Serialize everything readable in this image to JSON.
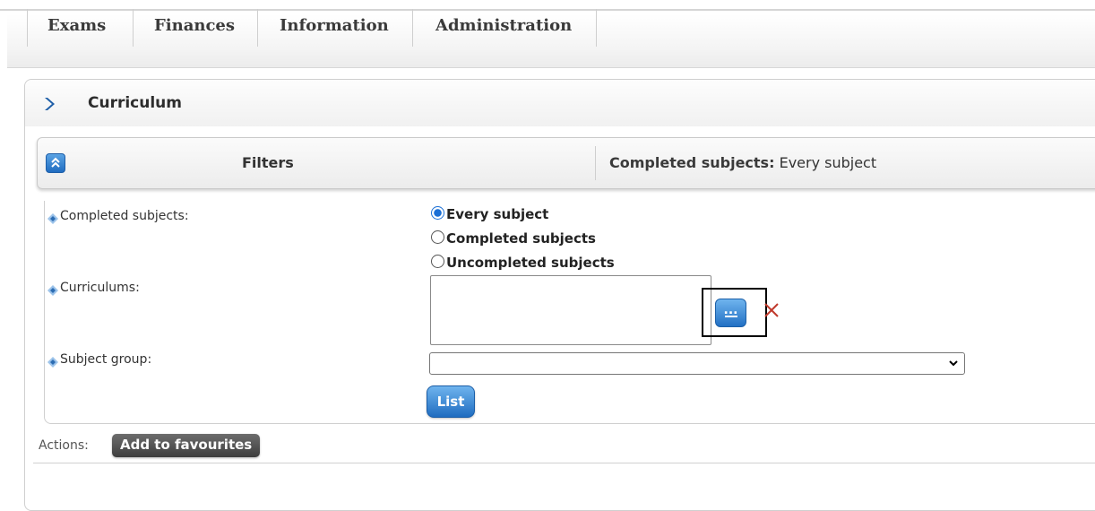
{
  "nav": {
    "items": [
      {
        "label": "Exams"
      },
      {
        "label": "Finances"
      },
      {
        "label": "Information"
      },
      {
        "label": "Administration"
      }
    ]
  },
  "panel": {
    "title": "Curriculum"
  },
  "filterbar": {
    "title": "Filters",
    "summary_label": "Completed subjects:",
    "summary_value": "Every subject"
  },
  "filters": {
    "completed_subjects": {
      "label": "Completed subjects:",
      "options": [
        {
          "label": "Every subject",
          "selected": true
        },
        {
          "label": "Completed subjects",
          "selected": false
        },
        {
          "label": "Uncompleted subjects",
          "selected": false
        }
      ]
    },
    "curriculums": {
      "label": "Curriculums:",
      "value": "",
      "browse_label": "..."
    },
    "subject_group": {
      "label": "Subject group:",
      "value": ""
    },
    "list_button": "List"
  },
  "actions": {
    "label": "Actions:",
    "add_to_favourites": "Add to favourites"
  },
  "colors": {
    "accent_blue": "#1f6cc0",
    "remove_red": "#c0392b",
    "favourite_button": "#4a4a4a"
  }
}
